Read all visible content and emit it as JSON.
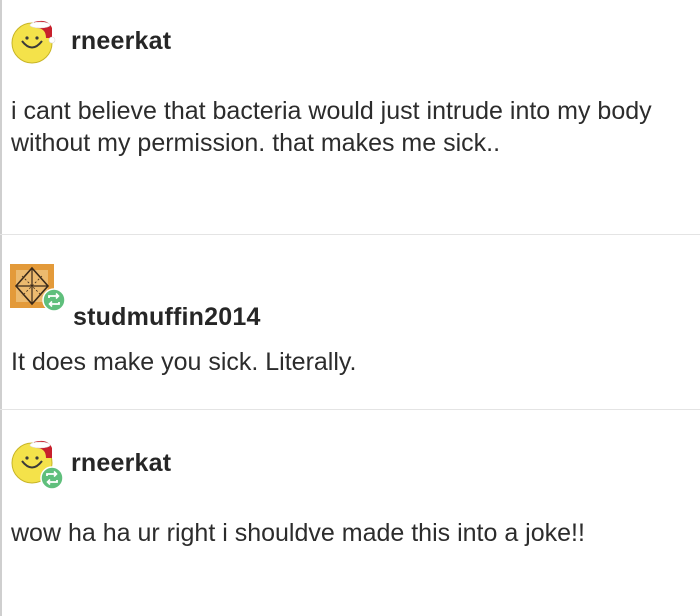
{
  "thread": {
    "posts": [
      {
        "username": "rneerkat",
        "avatar_icon": "smiley-santa-hat-icon",
        "text": "i cant believe that bacteria would just intrude into my body without my permission. that makes me sick..",
        "reblog_badge": false
      },
      {
        "username": "studmuffin2014",
        "avatar_icon": "geometric-envelope-icon",
        "text": "It does make you sick. Literally.",
        "reblog_badge": true
      },
      {
        "username": "rneerkat",
        "avatar_icon": "smiley-santa-hat-icon",
        "text": "wow ha ha ur right i shouldve made this into a joke!!",
        "reblog_badge": true
      }
    ]
  },
  "colors": {
    "reblog_green": "#5fbf7c",
    "avatar_yellow": "#f4e24a",
    "avatar_orange": "#e39a3a",
    "santa_red": "#c8202c",
    "divider": "#e4e4e4"
  }
}
